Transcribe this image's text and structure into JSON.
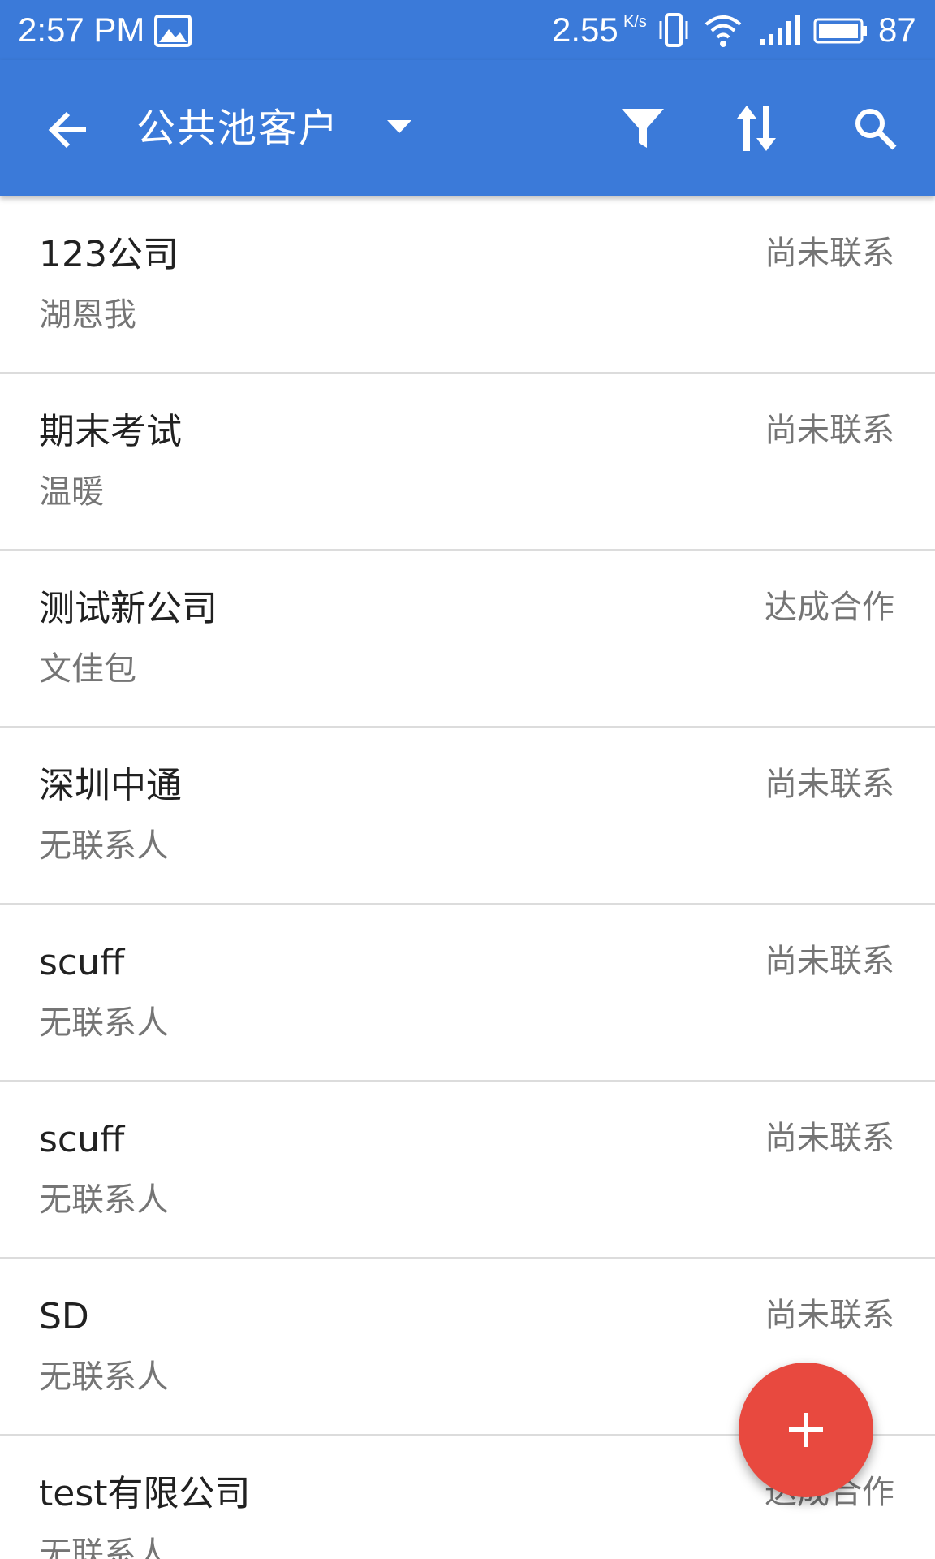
{
  "status_bar": {
    "time": "2:57 PM",
    "image_icon": "image-icon",
    "net_speed": "2.55",
    "net_speed_unit": "K/s",
    "vibrate_icon": "vibrate-icon",
    "wifi_icon": "wifi-icon",
    "signal_icon": "signal-icon",
    "battery_icon": "battery-icon",
    "battery_level": "87"
  },
  "toolbar": {
    "back_icon": "arrow-back-icon",
    "title": "公共池客户",
    "dropdown_icon": "caret-down-icon",
    "filter_icon": "filter-icon",
    "sort_icon": "sort-icon",
    "search_icon": "search-icon",
    "background_color": "#3b7ad9"
  },
  "customers": [
    {
      "name": "123公司",
      "contact": "湖恩我",
      "status": "尚未联系"
    },
    {
      "name": "期末考试",
      "contact": "温暖",
      "status": "尚未联系"
    },
    {
      "name": "测试新公司",
      "contact": "文佳包",
      "status": "达成合作"
    },
    {
      "name": "深圳中通",
      "contact": "无联系人",
      "status": "尚未联系"
    },
    {
      "name": "scuff",
      "contact": "无联系人",
      "status": "尚未联系"
    },
    {
      "name": "scuff",
      "contact": "无联系人",
      "status": "尚未联系"
    },
    {
      "name": "SD",
      "contact": "无联系人",
      "status": "尚未联系"
    },
    {
      "name": "test有限公司",
      "contact": "无联系人",
      "status": "达成合作"
    }
  ],
  "fab": {
    "icon": "plus-icon",
    "color": "#e8493f"
  }
}
